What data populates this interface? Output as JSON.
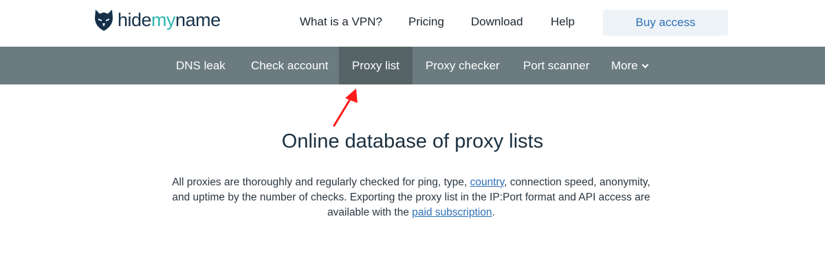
{
  "brand": {
    "logo_icon": "wolf-mask-icon",
    "name_part1": "hide",
    "name_part2": "my",
    "name_part3": "name",
    "accent_color": "#2db5b0"
  },
  "top_nav": {
    "items": [
      "What is a VPN?",
      "Pricing",
      "Download",
      "Help"
    ],
    "buy_label": "Buy access"
  },
  "sub_nav": {
    "items": [
      "DNS leak",
      "Check account",
      "Proxy list",
      "Proxy checker",
      "Port scanner",
      "More"
    ],
    "active": "Proxy list",
    "more_icon": "chevron-down-icon"
  },
  "annotation": {
    "icon": "red-arrow-icon",
    "color": "#ff1a1a"
  },
  "main": {
    "title": "Online database of proxy lists",
    "desc_part1": "All proxies are thoroughly and regularly checked for ping, type, ",
    "desc_link1": "country",
    "desc_part2": ", connection speed, anonymity, and uptime by the number of checks. Exporting the proxy list in the IP:Port format and API access are available with the ",
    "desc_link2": "paid subscription",
    "desc_part3": "."
  }
}
